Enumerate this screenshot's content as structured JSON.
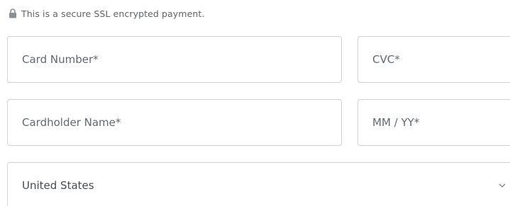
{
  "secure_note": {
    "text": "This is a secure SSL encrypted payment.",
    "icon": "lock-icon"
  },
  "fields": {
    "card_number": {
      "placeholder": "Card Number*",
      "value": ""
    },
    "cvc": {
      "placeholder": "CVC*",
      "value": ""
    },
    "cardholder_name": {
      "placeholder": "Cardholder Name*",
      "value": ""
    },
    "expiry": {
      "placeholder": "MM / YY*",
      "value": ""
    }
  },
  "country_select": {
    "selected": "United States",
    "icon": "chevron-down-icon"
  },
  "colors": {
    "border": "#cdd2d8",
    "placeholder_text": "#616870",
    "note_text": "#5f6368"
  }
}
